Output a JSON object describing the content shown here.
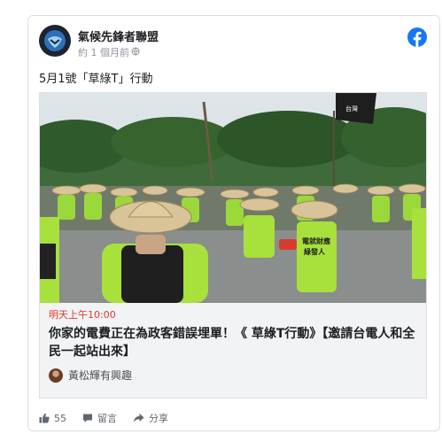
{
  "post": {
    "page_name": "氣候先鋒者聯盟",
    "timestamp": "約 1 個月前",
    "privacy_icon": "globe-icon",
    "text": "5月1號「草綠T」行動"
  },
  "event": {
    "time": "明天上午10:00",
    "title": "你家的電費正在為政客錯誤埋單！《 草綠T行動》【邀請台電人和全民一起站出來】",
    "interest": "黃松輝有興趣"
  },
  "photo": {
    "flag_text": "台灣",
    "shirt_text": "電就財應\n綠發人"
  },
  "actions": {
    "like_count": "55",
    "comment_label": "留言",
    "share_label": "分享"
  },
  "colors": {
    "facebook_blue": "#1877f2",
    "event_red": "#e03a2f",
    "shirt_green": "#a8e03c"
  }
}
